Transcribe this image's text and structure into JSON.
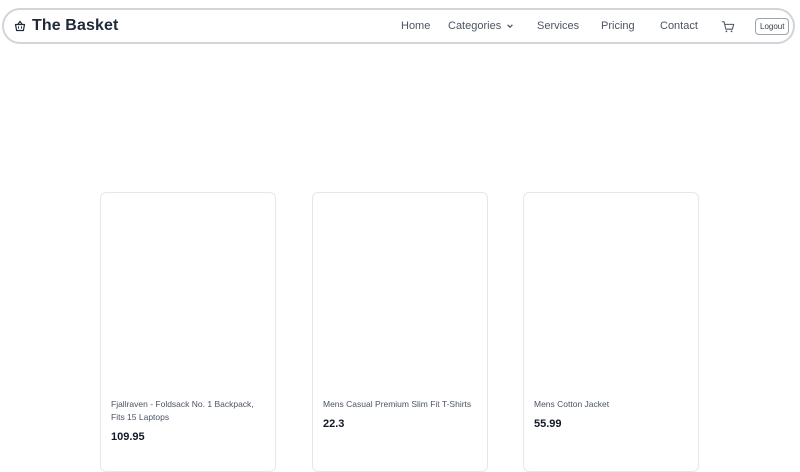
{
  "header": {
    "brand": "The Basket",
    "nav": [
      {
        "label": "Home"
      },
      {
        "label": "Categories"
      },
      {
        "label": "Services"
      },
      {
        "label": "Pricing"
      },
      {
        "label": "Contact"
      }
    ],
    "logout_label": "Logout",
    "icons": {
      "brand": "basket-icon",
      "dropdown": "chevron-down-icon",
      "cart": "cart-icon"
    }
  },
  "products": [
    {
      "title": "Fjallraven - Foldsack No. 1 Backpack, Fits 15 Laptops",
      "price": "109.95"
    },
    {
      "title": "Mens Casual Premium Slim Fit T-Shirts",
      "price": "22.3"
    },
    {
      "title": "Mens Cotton Jacket",
      "price": "55.99"
    }
  ],
  "colors": {
    "border": "#d1d5db",
    "text": "#1f2937",
    "muted": "#4b5563"
  }
}
